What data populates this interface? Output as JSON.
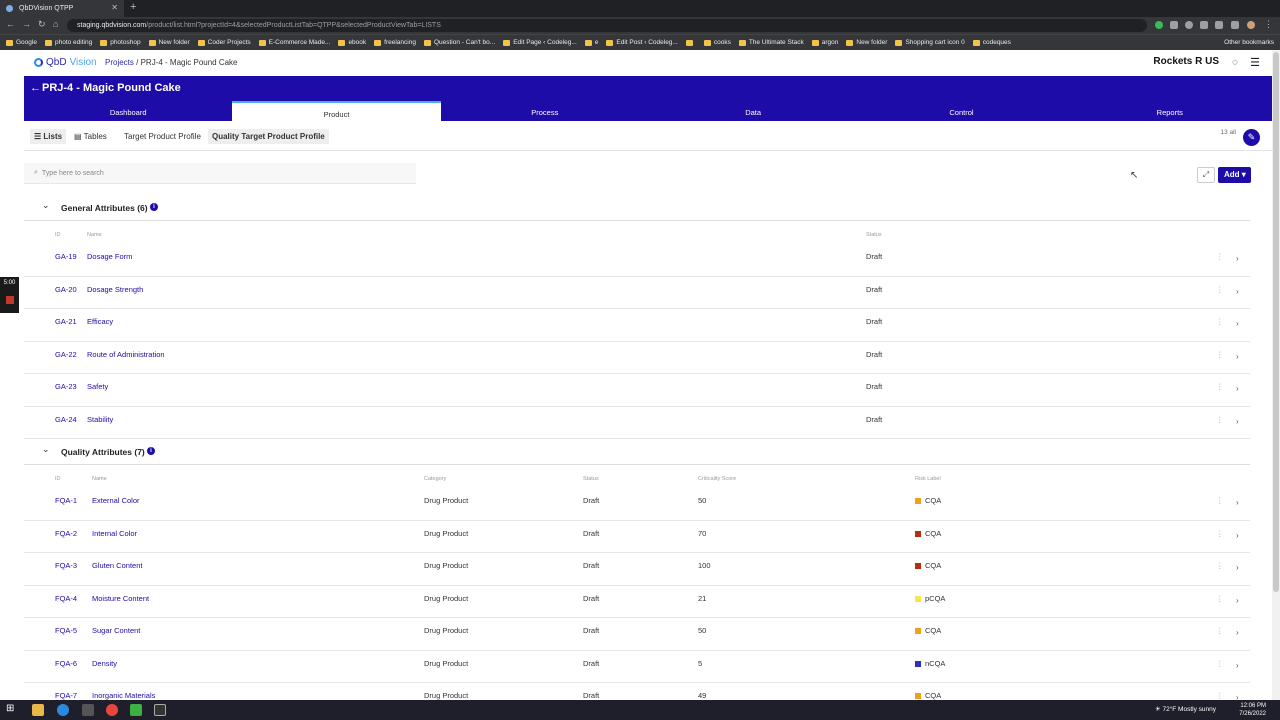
{
  "browser": {
    "tab_title": "QbDVision QTPP",
    "url_host": "staging.qbdvision.com",
    "url_path": "/product/list.html?projectId=4&selectedProductListTab=QTPP&selectedProductViewTab=LISTS",
    "bookmarks": [
      "Google",
      "photo editing",
      "photoshop",
      "New folder",
      "Coder Projects",
      "E-Commerce Made...",
      "ebook",
      "freelancing",
      "Question - Can't bo...",
      "Edit Page ‹ Codeleg...",
      "e",
      "Edit Post ‹ Codeleg...",
      "",
      "cooks",
      "The Ultimate Stack",
      "argon",
      "New folder",
      "Shopping cart icon 0",
      "codeques"
    ],
    "other_bookmarks": "Other bookmarks"
  },
  "app": {
    "logo_a": "QbD",
    "logo_b": "Vision",
    "breadcrumb_projects": "Projects",
    "breadcrumb_sep": " / ",
    "breadcrumb_current": "PRJ-4 - Magic Pound Cake",
    "company": "Rockets R US",
    "back": "←",
    "project_title": "PRJ-4 - Magic Pound Cake",
    "tabs": [
      "Dashboard",
      "Product",
      "Process",
      "Data",
      "Control",
      "Reports"
    ],
    "subnav": [
      "Lists",
      "Tables",
      "Target Product Profile",
      "Quality Target Product Profile"
    ],
    "count": "13 all",
    "search_placeholder": "Type here to search",
    "add_label": "Add"
  },
  "general": {
    "title": "General Attributes (6)",
    "headers": [
      "ID",
      "Name",
      "Status"
    ],
    "rows": [
      {
        "id": "GA-19",
        "name": "Dosage Form",
        "status": "Draft"
      },
      {
        "id": "GA-20",
        "name": "Dosage Strength",
        "status": "Draft"
      },
      {
        "id": "GA-21",
        "name": "Efficacy",
        "status": "Draft"
      },
      {
        "id": "GA-22",
        "name": "Route of Administration",
        "status": "Draft"
      },
      {
        "id": "GA-23",
        "name": "Safety",
        "status": "Draft"
      },
      {
        "id": "GA-24",
        "name": "Stability",
        "status": "Draft"
      }
    ]
  },
  "quality": {
    "title": "Quality Attributes (7)",
    "headers": [
      "ID",
      "Name",
      "Category",
      "Status",
      "Criticality Score",
      "Risk Label"
    ],
    "rows": [
      {
        "id": "FQA-1",
        "name": "External Color",
        "category": "Drug Product",
        "status": "Draft",
        "score": "50",
        "risk": "CQA",
        "risk_color": "#f0a020"
      },
      {
        "id": "FQA-2",
        "name": "Internal Color",
        "category": "Drug Product",
        "status": "Draft",
        "score": "70",
        "risk": "CQA",
        "risk_color": "#b03010"
      },
      {
        "id": "FQA-3",
        "name": "Gluten Content",
        "category": "Drug Product",
        "status": "Draft",
        "score": "100",
        "risk": "CQA",
        "risk_color": "#b03010"
      },
      {
        "id": "FQA-4",
        "name": "Moisture Content",
        "category": "Drug Product",
        "status": "Draft",
        "score": "21",
        "risk": "pCQA",
        "risk_color": "#f5e84a"
      },
      {
        "id": "FQA-5",
        "name": "Sugar Content",
        "category": "Drug Product",
        "status": "Draft",
        "score": "50",
        "risk": "CQA",
        "risk_color": "#f0a020"
      },
      {
        "id": "FQA-6",
        "name": "Density",
        "category": "Drug Product",
        "status": "Draft",
        "score": "5",
        "risk": "nCQA",
        "risk_color": "#3030c0"
      },
      {
        "id": "FQA-7",
        "name": "Inorganic Materials",
        "category": "Drug Product",
        "status": "Draft",
        "score": "49",
        "risk": "CQA",
        "risk_color": "#f0a020"
      }
    ]
  },
  "overlay": {
    "timer": "5:00"
  },
  "taskbar": {
    "weather": "72°F  Mostly sunny",
    "time": "12:06 PM",
    "date": "7/26/2022"
  }
}
